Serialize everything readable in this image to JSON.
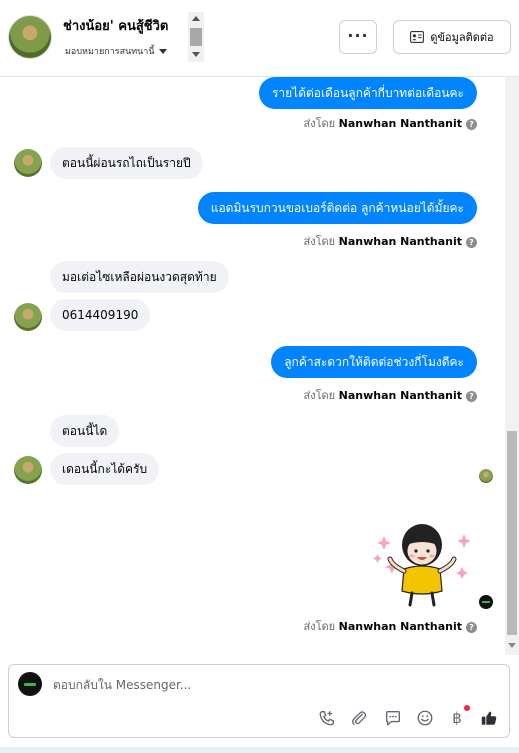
{
  "header": {
    "contact_name": "ช่างน้อย' คนสู้ชีวิต",
    "assign_label": "มอบหมายการสนทนานี้",
    "more_label": "···",
    "contact_info_label": "ดูข้อมูลติดต่อ"
  },
  "sender_prefix": "ส่งโดย",
  "sender_name": "Nanwhan Nanthanit",
  "info_mark": "?",
  "messages": [
    {
      "direction": "outgoing",
      "text": "รายได้ต่อเดือนลูกค้ากี่บาทต่อเดือนคะ"
    },
    {
      "direction": "incoming",
      "text": "ตอนนี้ผ่อนรถไถเป็นรายปี"
    },
    {
      "direction": "outgoing",
      "text": "แอดมินรบกวนขอเบอร์ติดต่อ ลูกค้าหน่อยได้มั้ยคะ"
    },
    {
      "direction": "incoming",
      "text": "มอเต่อไซเหลือผ่อนงวดสุดท้าย"
    },
    {
      "direction": "incoming",
      "text": "0614409190"
    },
    {
      "direction": "outgoing",
      "text": "ลูกค้าสะดวกให้ติดต่อช่วงกี่โมงดีคะ"
    },
    {
      "direction": "incoming",
      "text": "ตอนนี้ได"
    },
    {
      "direction": "incoming",
      "text": "เดอนนี้กะได้ครับ"
    },
    {
      "direction": "outgoing",
      "type": "sticker",
      "sticker": "girl-cheering-sticker"
    }
  ],
  "composer": {
    "placeholder": "ตอบกลับใน Messenger...",
    "tools": [
      "call-icon",
      "attachment-icon",
      "saved-reply-icon",
      "emoji-icon",
      "payment-icon",
      "like-icon"
    ],
    "baht_symbol": "฿",
    "notification_color": "#f02849"
  },
  "colors": {
    "outgoing_bubble": "#0084ff",
    "incoming_bubble": "#f0f2f5"
  }
}
